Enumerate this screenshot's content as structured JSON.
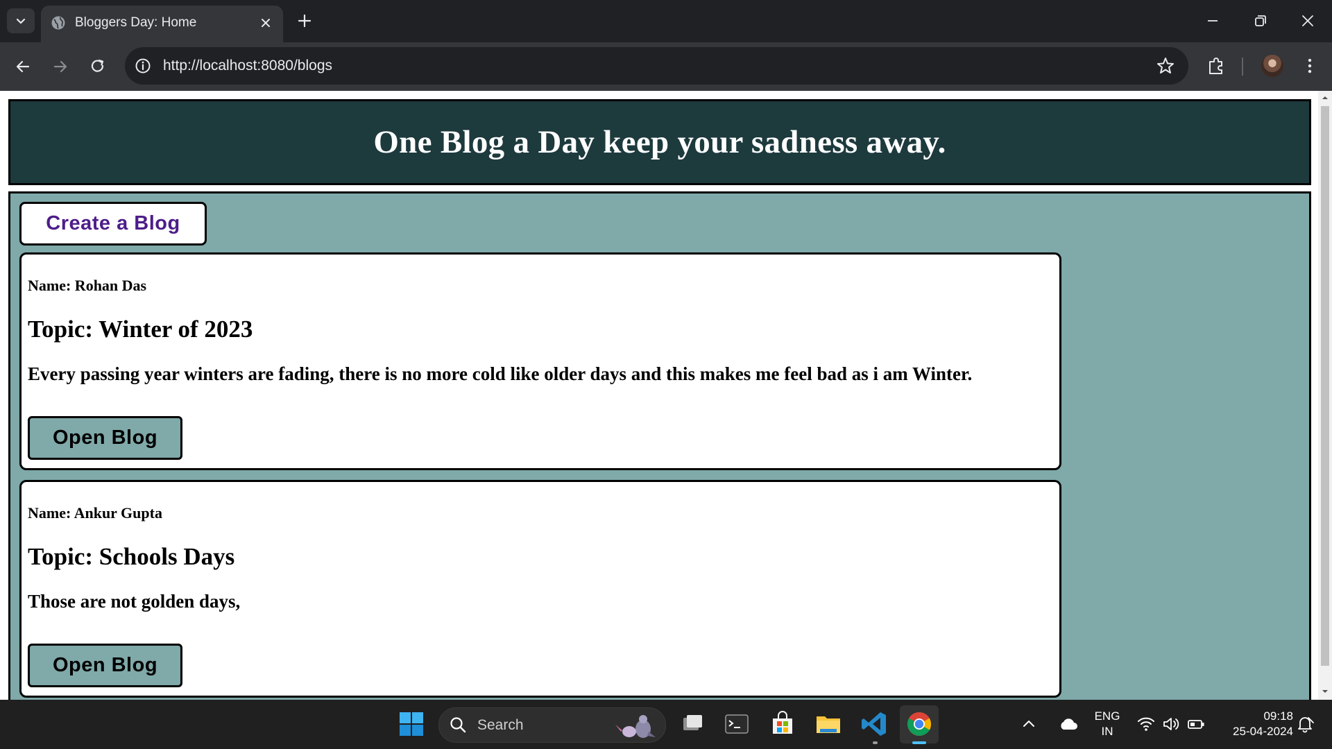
{
  "browser": {
    "tab_title": "Bloggers Day: Home",
    "url": "http://localhost:8080/blogs"
  },
  "page": {
    "hero_title": "One Blog a Day keep your sadness away.",
    "create_button": "Create a Blog",
    "blogs": [
      {
        "name": "Name: Rohan Das",
        "topic": "Topic: Winter of 2023",
        "content": "Every passing year winters are fading, there is no more cold like older days and this makes me feel bad as i am Winter.",
        "button": "Open Blog"
      },
      {
        "name": "Name: Ankur Gupta",
        "topic": "Topic: Schools Days",
        "content": "Those are not golden days,",
        "button": "Open Blog"
      }
    ]
  },
  "taskbar": {
    "search_label": "Search",
    "language": "ENG",
    "region": "IN",
    "time": "09:18",
    "date": "25-04-2024"
  },
  "colors": {
    "hero_bg": "#1d3a3d",
    "main_bg": "#80a9a9",
    "create_text": "#4d1d8a"
  }
}
